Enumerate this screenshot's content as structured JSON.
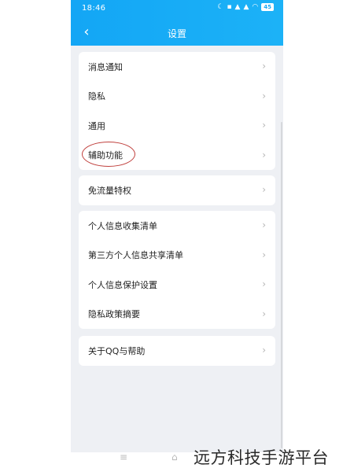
{
  "status_bar": {
    "time": "18:46",
    "icons": [
      "moon-icon",
      "hd-icon",
      "signal-icon",
      "signal-icon",
      "wifi-icon"
    ],
    "battery": "45"
  },
  "header": {
    "title": "设置",
    "back_glyph": "‹"
  },
  "groups": [
    {
      "items": [
        {
          "label": "消息通知"
        },
        {
          "label": "隐私"
        },
        {
          "label": "通用"
        },
        {
          "label": "辅助功能",
          "highlighted": true
        }
      ]
    },
    {
      "items": [
        {
          "label": "免流量特权"
        }
      ]
    },
    {
      "items": [
        {
          "label": "个人信息收集清单"
        },
        {
          "label": "第三方个人信息共享清单"
        },
        {
          "label": "个人信息保护设置"
        },
        {
          "label": "隐私政策摘要"
        }
      ]
    },
    {
      "items": [
        {
          "label": "关于QQ与帮助"
        }
      ]
    }
  ],
  "chevron": "›",
  "nav_hint": {
    "menu_glyph": "≡",
    "home_glyph": "⌂"
  },
  "watermark": "远方科技手游平台",
  "colors": {
    "header": "#13a6f5",
    "background": "#eef0f4",
    "annotation_circle": "#c0403d"
  }
}
